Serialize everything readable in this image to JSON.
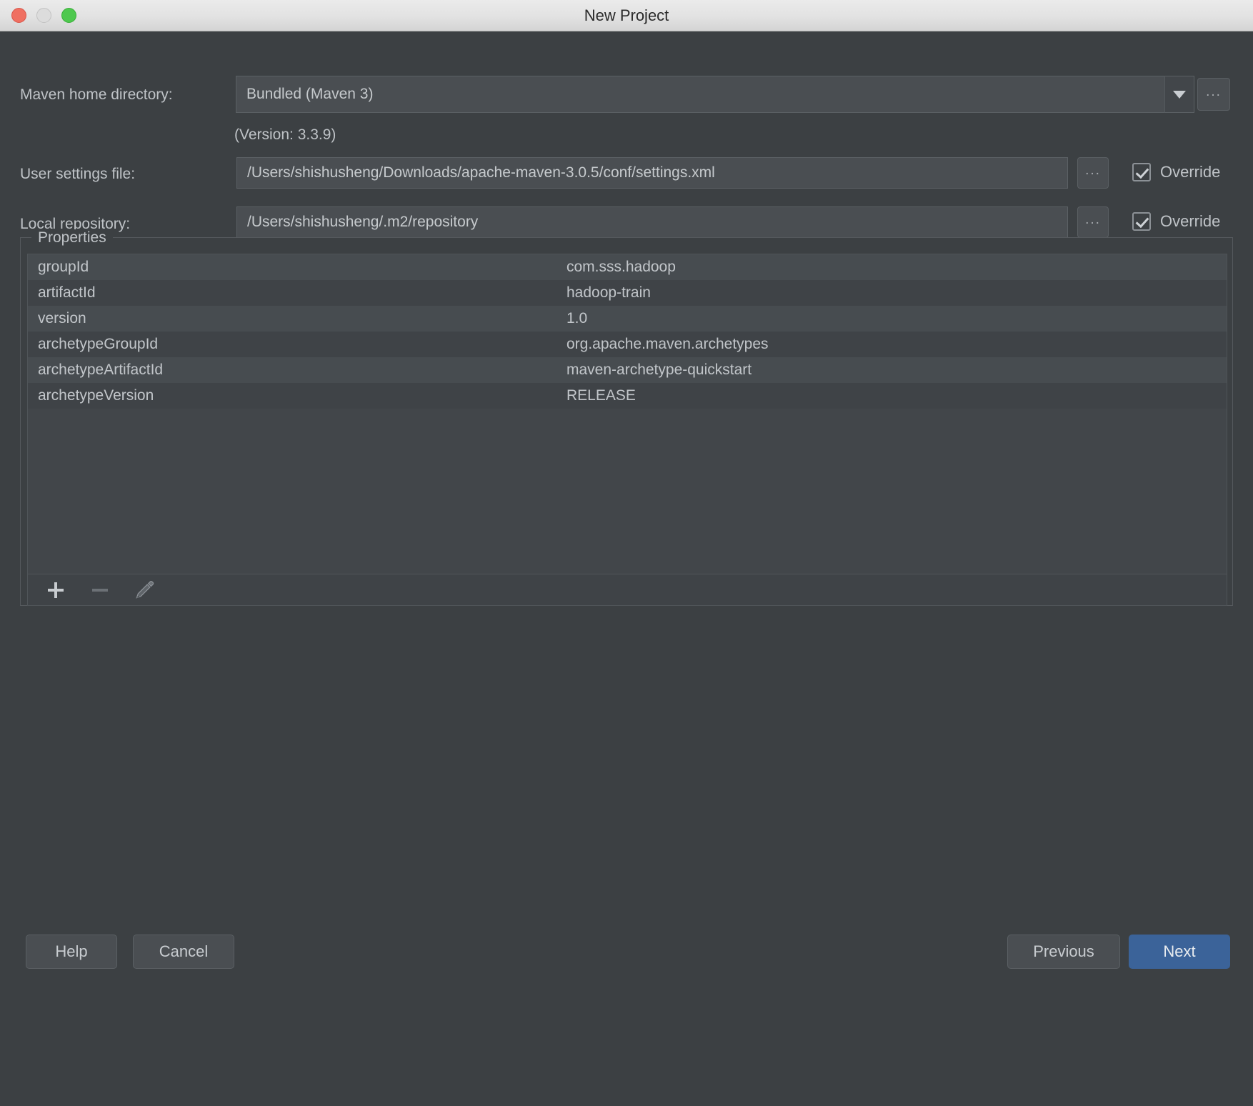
{
  "window": {
    "title": "New Project",
    "traffic_lights": [
      "close-button",
      "minimize-button",
      "maximize-button"
    ]
  },
  "form": {
    "maven_home": {
      "label": "Maven home directory:",
      "value": "Bundled (Maven 3)",
      "browse_label": "...",
      "dropdown_icon": "chevron-down-icon"
    },
    "version_note": "(Version: 3.3.9)",
    "user_settings": {
      "label": "User settings file:",
      "value": "/Users/shishusheng/Downloads/apache-maven-3.0.5/conf/settings.xml",
      "browse_label": "...",
      "override_label": "Override",
      "override_checked": true
    },
    "local_repository": {
      "label": "Local repository:",
      "value": "/Users/shishusheng/.m2/repository",
      "browse_label": "...",
      "override_label": "Override",
      "override_checked": true
    }
  },
  "properties": {
    "group_title": "Properties",
    "rows": [
      {
        "key": "groupId",
        "value": "com.sss.hadoop"
      },
      {
        "key": "artifactId",
        "value": "hadoop-train"
      },
      {
        "key": "version",
        "value": "1.0"
      },
      {
        "key": "archetypeGroupId",
        "value": "org.apache.maven.archetypes"
      },
      {
        "key": "archetypeArtifactId",
        "value": "maven-archetype-quickstart"
      },
      {
        "key": "archetypeVersion",
        "value": "RELEASE"
      }
    ],
    "toolbar": {
      "add_icon": "plus-icon",
      "remove_icon": "minus-icon",
      "edit_icon": "pencil-icon"
    }
  },
  "footer": {
    "help_label": "Help",
    "cancel_label": "Cancel",
    "previous_label": "Previous",
    "next_label": "Next"
  },
  "colors": {
    "background": "#3c4043",
    "field": "#4a4e52",
    "primary_button": "#3b6399",
    "text": "#bfc3c7"
  }
}
